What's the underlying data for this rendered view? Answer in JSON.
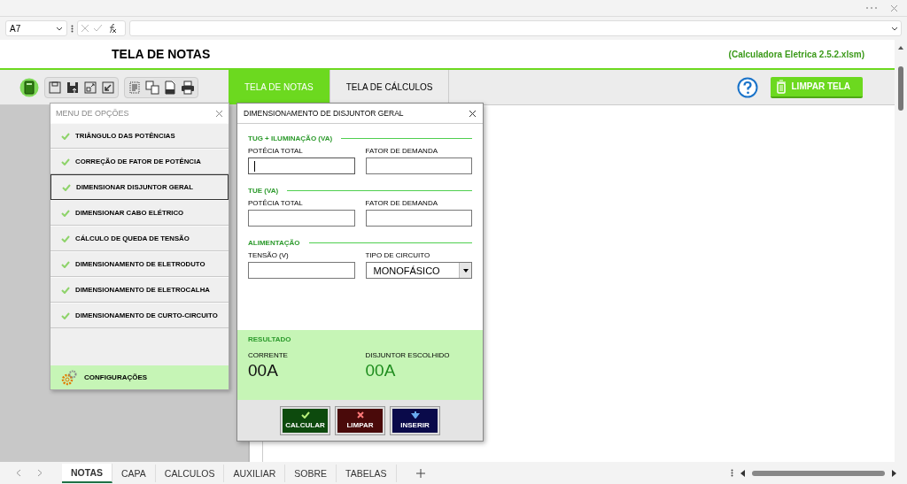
{
  "formula_bar": {
    "name_box": "A7"
  },
  "sheet": {
    "title": "TELA DE NOTAS",
    "file_label": "(Calculadora Eletrica 2.5.2.xlsm)",
    "tabs": [
      {
        "label": "TELA DE NOTAS",
        "selected": true
      },
      {
        "label": "TELA DE CÁLCULOS",
        "selected": false
      }
    ],
    "clear_button": "LIMPAR TELA"
  },
  "menu": {
    "title": "MENU DE OPÇÕES",
    "items": [
      {
        "label": "TRIÂNGULO DAS POTÊNCIAS",
        "selected": false
      },
      {
        "label": "CORREÇÃO DE FATOR DE POTÊNCIA",
        "selected": false
      },
      {
        "label": "DIMENSIONAR DISJUNTOR GERAL",
        "selected": true
      },
      {
        "label": "DIMENSIONAR CABO ELÉTRICO",
        "selected": false
      },
      {
        "label": "CÁLCULO DE QUEDA DE TENSÃO",
        "selected": false
      },
      {
        "label": "DIMENSIONAMENTO DE ELETRODUTO",
        "selected": false
      },
      {
        "label": "DIMENSIONAMENTO DE ELETROCALHA",
        "selected": false
      },
      {
        "label": "DIMENSIONAMENTO DE CURTO-CIRCUITO",
        "selected": false
      }
    ],
    "settings": "CONFIGURAÇÕES"
  },
  "dialog": {
    "title": "DIMENSIONAMENTO DE DISJUNTOR GERAL",
    "sections": [
      {
        "heading": "TUG + ILUMINAÇÃO (VA)",
        "fields": [
          {
            "label": "POTÊCIA TOTAL",
            "kind": "text",
            "focused": true
          },
          {
            "label": "FATOR DE DEMANDA",
            "kind": "text",
            "focused": false
          }
        ]
      },
      {
        "heading": "TUE (VA)",
        "fields": [
          {
            "label": "POTÊCIA TOTAL",
            "kind": "text",
            "focused": false
          },
          {
            "label": "FATOR DE DEMANDA",
            "kind": "text",
            "focused": false
          }
        ]
      },
      {
        "heading": "ALIMENTAÇÃO",
        "fields": [
          {
            "label": "TENSÃO (V)",
            "kind": "text",
            "focused": false
          },
          {
            "label": "TIPO DE CIRCUITO",
            "kind": "dropdown",
            "value": "MONOFÁSICO",
            "focused": false
          }
        ]
      }
    ],
    "result": {
      "heading": "RESULTADO",
      "items": [
        {
          "label": "CORRENTE",
          "value": "00A",
          "color": "#111111"
        },
        {
          "label": "DISJUNTOR ESCOLHIDO",
          "value": "00A",
          "color": "#1e8c1e"
        }
      ]
    },
    "buttons": [
      {
        "label": "CALCULAR",
        "kind": "confirm"
      },
      {
        "label": "LIMPAR",
        "kind": "clear"
      },
      {
        "label": "INSERIR",
        "kind": "insert"
      }
    ]
  },
  "sheet_tabs": [
    {
      "label": "NOTAS",
      "selected": true
    },
    {
      "label": "CAPA",
      "selected": false
    },
    {
      "label": "CALCULOS",
      "selected": false
    },
    {
      "label": "AUXILIAR",
      "selected": false
    },
    {
      "label": "SOBRE",
      "selected": false
    },
    {
      "label": "TABELAS",
      "selected": false
    }
  ]
}
